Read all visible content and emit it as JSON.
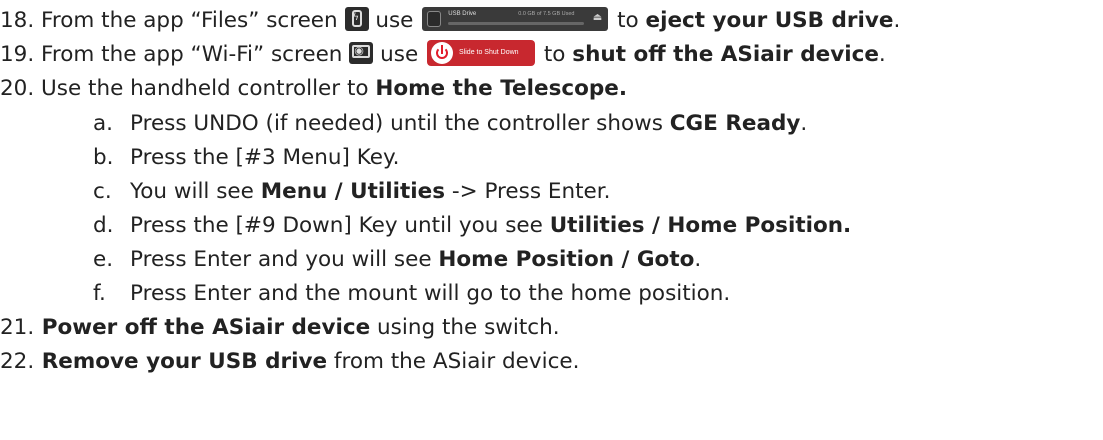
{
  "steps": [
    {
      "num": "18.",
      "pre": " From the app “Files” screen ",
      "use": " use ",
      "post": " to ",
      "bold": "eject your USB drive",
      "end": "."
    },
    {
      "num": "19.",
      "pre": " From the app “Wi-Fi” screen ",
      "use": " use ",
      "post": " to ",
      "bold": "shut off the ASiair device",
      "end": "."
    },
    {
      "num": "20.",
      "text": " Use the handheld controller to ",
      "bold": "Home the Telescope."
    },
    {
      "num": "21.",
      "bold": " Power off the ASiair device",
      "text": " using the switch."
    },
    {
      "num": "22.",
      "bold": " Remove your USB drive",
      "text": " from the ASiair device."
    }
  ],
  "substeps": [
    {
      "letter": "a.",
      "text": "Press UNDO (if needed) until the controller shows ",
      "bold": "CGE Ready",
      "end": "."
    },
    {
      "letter": "b.",
      "text": "Press the [#3 Menu] Key."
    },
    {
      "letter": "c.",
      "text": "You will see ",
      "bold": "Menu / Utilities",
      "end": " -> Press Enter."
    },
    {
      "letter": "d.",
      "text": "Press the [#9 Down] Key until you see ",
      "bold": "Utilities / Home Position."
    },
    {
      "letter": "e.",
      "text": "Press Enter and you will see ",
      "bold": "Home Position / Goto",
      "end": "."
    },
    {
      "letter": "f.",
      "text": "Press Enter and the mount will go to the home position."
    }
  ],
  "usb_widget": {
    "label": "USB Drive",
    "used": "0.0 GB of 7.5 GB Used"
  },
  "shutdown_widget": {
    "label": "Slide to Shut Down"
  },
  "icons": [
    "usb-drive-icon",
    "eject-icon",
    "wifi-icon",
    "power-icon"
  ]
}
